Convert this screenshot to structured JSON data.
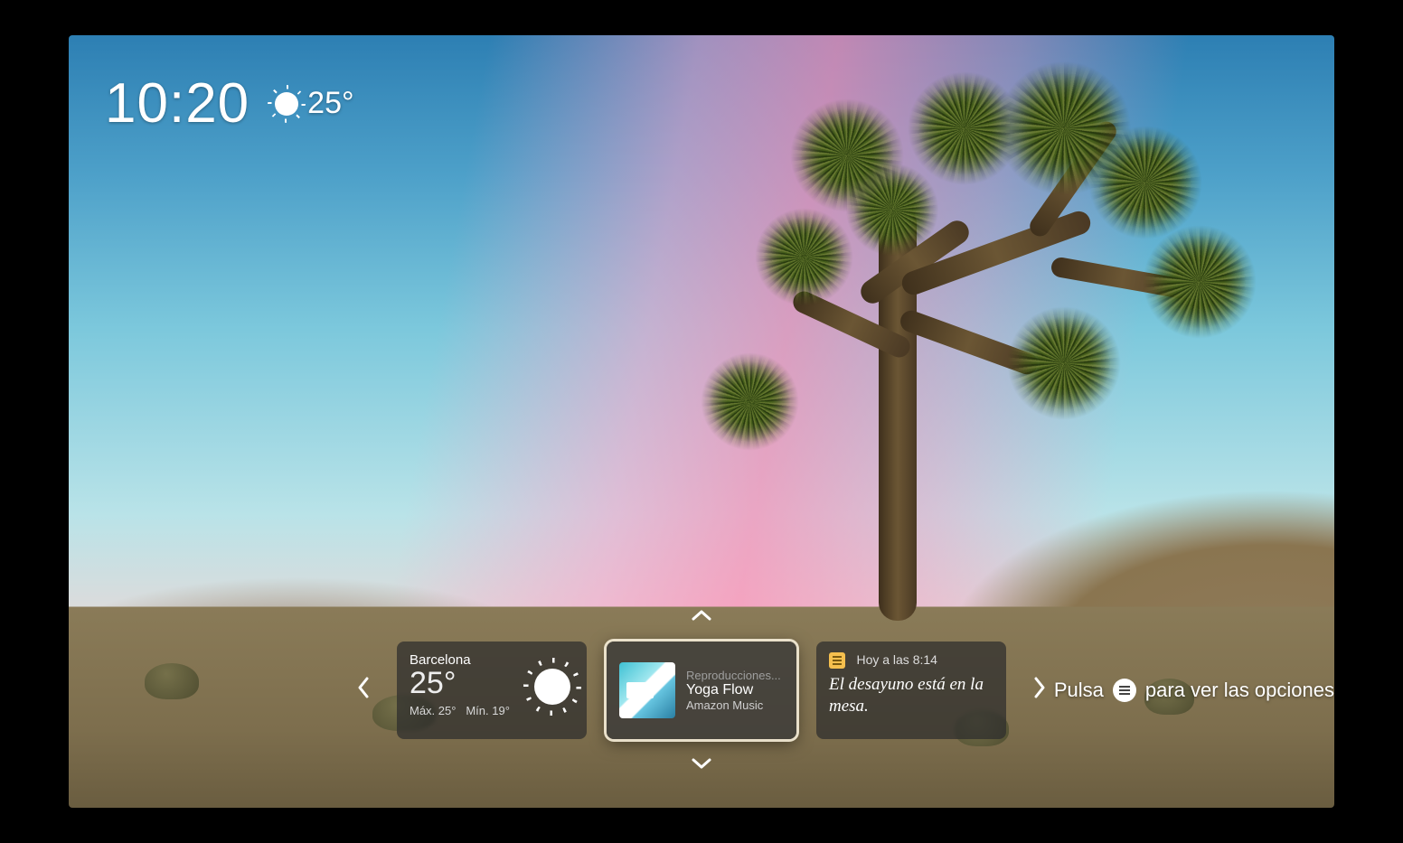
{
  "status": {
    "time": "10:20",
    "temp": "25°"
  },
  "carousel": {
    "weather": {
      "city": "Barcelona",
      "temp": "25°",
      "hi_label": "Máx.",
      "hi": "25°",
      "lo_label": "Mín.",
      "lo": "19°"
    },
    "music": {
      "eyebrow": "Reproducciones...",
      "title": "Yoga Flow",
      "provider": "Amazon Music"
    },
    "note": {
      "time_label": "Hoy a las 8:14",
      "message": "El desayuno está en la mesa."
    }
  },
  "hint": {
    "pre": "Pulsa",
    "post": "para ver las opciones"
  }
}
